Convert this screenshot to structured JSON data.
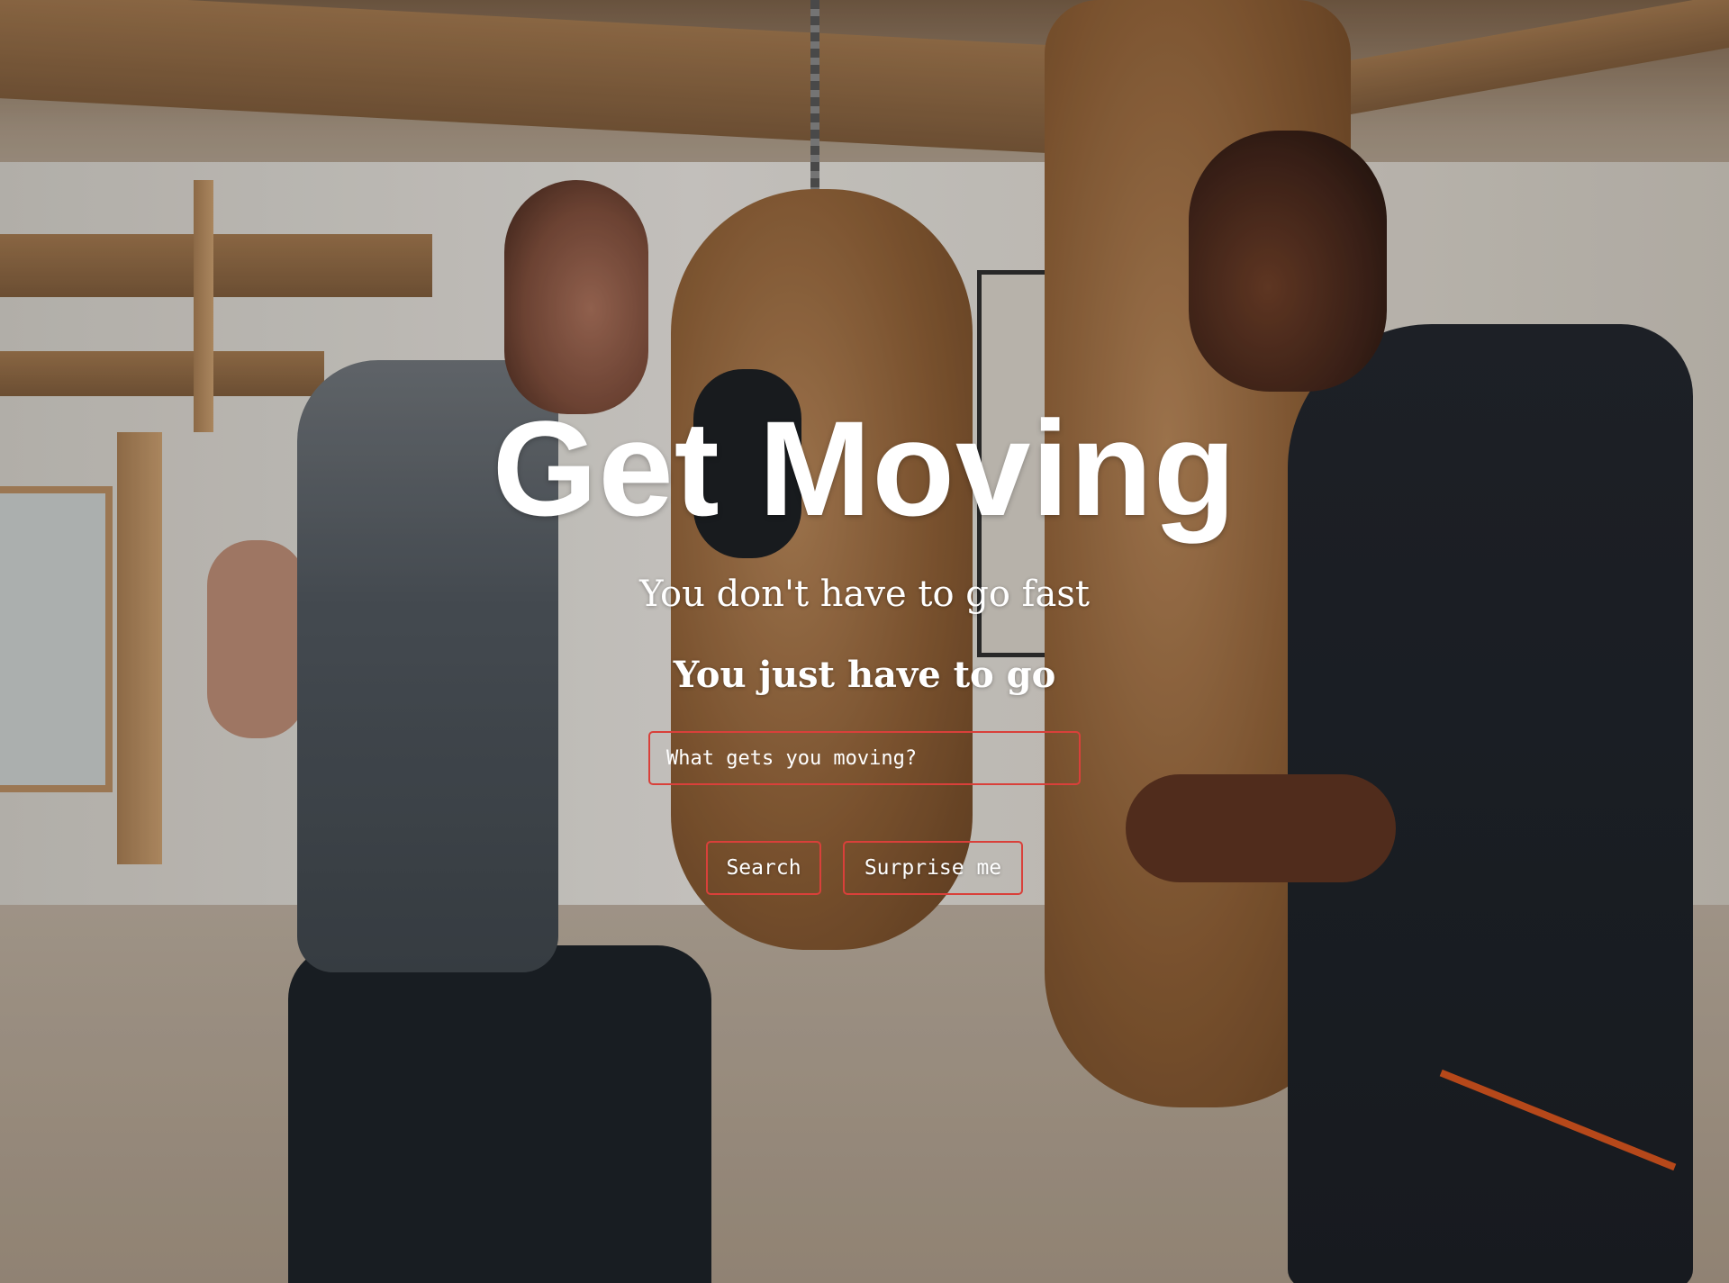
{
  "hero": {
    "title": "Get Moving",
    "subtitle": "You don't have to go fast",
    "tagline": "You just have to go"
  },
  "search": {
    "placeholder": "What gets you moving?",
    "value": ""
  },
  "buttons": {
    "search_label": "Search",
    "surprise_label": "Surprise me"
  },
  "colors": {
    "accent_border": "#d9403a",
    "text": "#ffffff"
  },
  "background": {
    "description_icon": "boxing-gym-photo"
  }
}
